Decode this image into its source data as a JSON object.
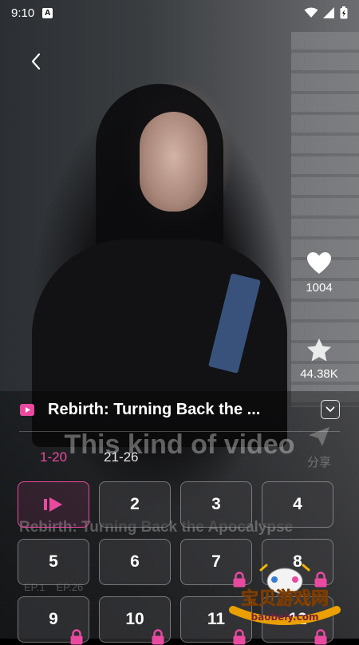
{
  "status": {
    "time": "9:10",
    "badge": "A"
  },
  "nav": {
    "back_icon": "chevron-left-icon"
  },
  "actions": {
    "likes": "1004",
    "favorites": "44.38K",
    "share": "分享"
  },
  "overlay_text": {
    "subtitle": "This kind of video",
    "title_watermark": "Rebirth: Turning Back the Apocalypse",
    "ep_hint": [
      "EP.1",
      "EP.26"
    ]
  },
  "drama": {
    "title": "Rebirth: Turning Back the ..."
  },
  "tabs": [
    {
      "label": "1-20",
      "active": true
    },
    {
      "label": "21-26",
      "active": false
    }
  ],
  "episodes": [
    {
      "label": "",
      "playing": true,
      "locked": false
    },
    {
      "label": "2",
      "playing": false,
      "locked": false
    },
    {
      "label": "3",
      "playing": false,
      "locked": false
    },
    {
      "label": "4",
      "playing": false,
      "locked": false
    },
    {
      "label": "5",
      "playing": false,
      "locked": false
    },
    {
      "label": "6",
      "playing": false,
      "locked": false
    },
    {
      "label": "7",
      "playing": false,
      "locked": true
    },
    {
      "label": "8",
      "playing": false,
      "locked": true
    },
    {
      "label": "9",
      "playing": false,
      "locked": true
    },
    {
      "label": "10",
      "playing": false,
      "locked": true
    },
    {
      "label": "11",
      "playing": false,
      "locked": true
    },
    {
      "label": "12",
      "playing": false,
      "locked": true
    }
  ],
  "watermark": {
    "title": "宝贝游戏网",
    "url": "baobeiy.com"
  },
  "colors": {
    "accent": "#e94aa0"
  }
}
